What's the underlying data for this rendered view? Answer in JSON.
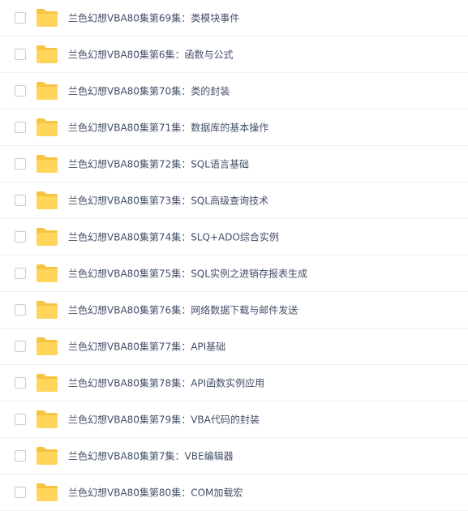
{
  "colors": {
    "folder": "#ffd55c",
    "folder_tab": "#f7c341",
    "text": "#424e67",
    "divider": "#eef0f3",
    "checkbox_border": "#c7cbd3"
  },
  "icons": {
    "checkbox": "checkbox-unchecked",
    "folder": "folder-icon"
  },
  "files": [
    {
      "name": "兰色幻想VBA80集第69集：类模块事件"
    },
    {
      "name": "兰色幻想VBA80集第6集：函数与公式"
    },
    {
      "name": "兰色幻想VBA80集第70集：类的封装"
    },
    {
      "name": "兰色幻想VBA80集第71集：数据库的基本操作"
    },
    {
      "name": "兰色幻想VBA80集第72集：SQL语言基础"
    },
    {
      "name": "兰色幻想VBA80集第73集：SQL高级查询技术"
    },
    {
      "name": "兰色幻想VBA80集第74集：SLQ+ADO综合实例"
    },
    {
      "name": "兰色幻想VBA80集第75集：SQL实例之进销存报表生成"
    },
    {
      "name": "兰色幻想VBA80集第76集：网络数据下载与邮件发送"
    },
    {
      "name": "兰色幻想VBA80集第77集：API基础"
    },
    {
      "name": "兰色幻想VBA80集第78集：API函数实例应用"
    },
    {
      "name": "兰色幻想VBA80集第79集：VBA代码的封装"
    },
    {
      "name": "兰色幻想VBA80集第7集：VBE编辑器"
    },
    {
      "name": "兰色幻想VBA80集第80集：COM加载宏"
    }
  ]
}
